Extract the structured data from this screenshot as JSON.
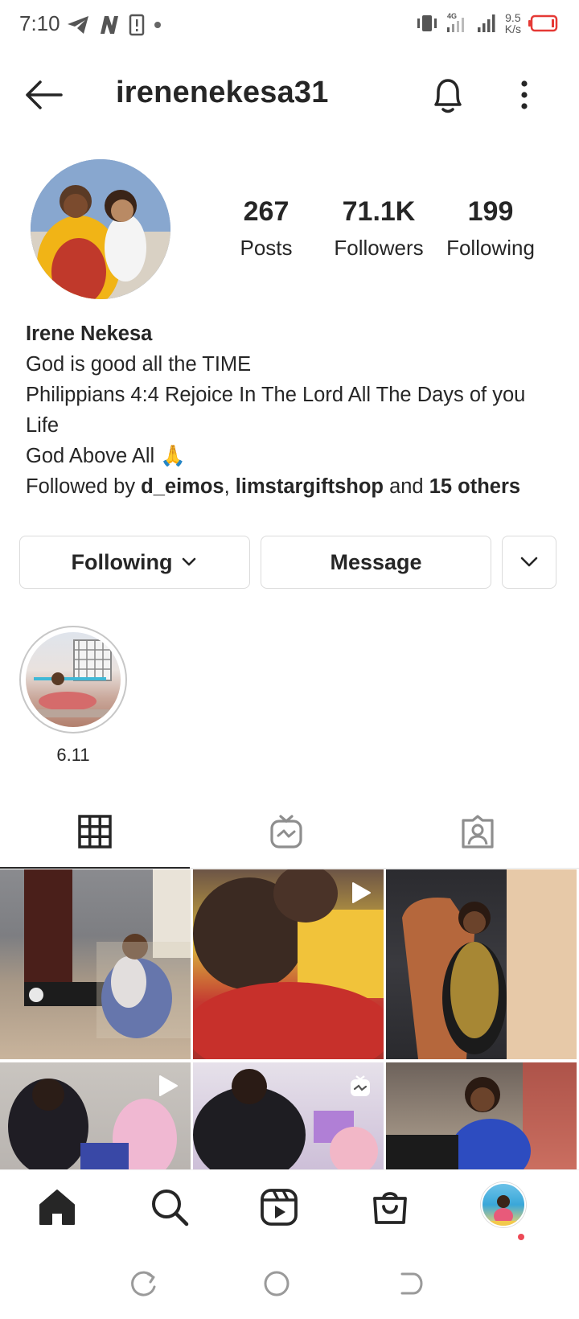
{
  "status_bar": {
    "time": "7:10",
    "network": "4G",
    "speed_value": "9.5",
    "speed_unit": "K/s",
    "battery_color": "#e53935"
  },
  "header": {
    "username": "irenenekesa31",
    "icons": [
      "back-arrow-icon",
      "bell-icon",
      "more-vertical-icon"
    ]
  },
  "profile": {
    "stats": [
      {
        "value": "267",
        "label": "Posts"
      },
      {
        "value": "71.1K",
        "label": "Followers"
      },
      {
        "value": "199",
        "label": "Following"
      }
    ],
    "name": "Irene Nekesa",
    "bio_lines": [
      "God is good all the TIME",
      "Philippians 4:4 Rejoice In The Lord All The Days of you Life",
      "God Above All 🙏"
    ],
    "followed_by": {
      "prefix": "Followed by ",
      "user1": "d_eimos",
      "sep": ", ",
      "user2": "limstargiftshop",
      "mid": " and ",
      "others": "15 others"
    }
  },
  "actions": {
    "following_label": "Following",
    "message_label": "Message"
  },
  "highlight": {
    "label": "6.11"
  },
  "tabs": [
    "grid-icon",
    "igtv-icon",
    "tagged-icon"
  ],
  "bottom_nav": [
    "home-icon",
    "search-icon",
    "reels-icon",
    "shop-icon",
    "profile-avatar"
  ],
  "accent_colors": {
    "notification_dot": "#ed4956",
    "text": "#262626",
    "border": "#dbdbdb"
  }
}
